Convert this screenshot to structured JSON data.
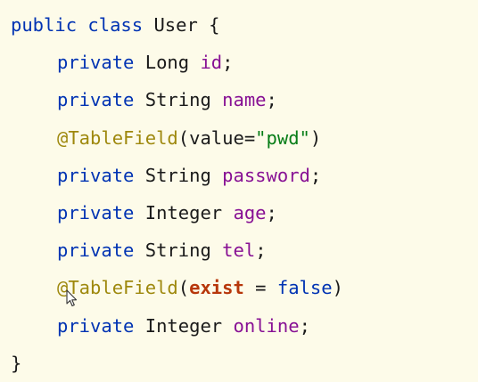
{
  "editor": {
    "lines": [
      {
        "indent": false,
        "tokens": [
          {
            "text": "public",
            "cls": "kw"
          },
          {
            "text": " class ",
            "cls": "kw"
          },
          {
            "text": "User {",
            "cls": "plain"
          }
        ]
      },
      {
        "indent": true,
        "tokens": [
          {
            "text": "private",
            "cls": "kw"
          },
          {
            "text": " Long ",
            "cls": "type"
          },
          {
            "text": "id",
            "cls": "field"
          },
          {
            "text": ";",
            "cls": "plain"
          }
        ]
      },
      {
        "indent": true,
        "tokens": [
          {
            "text": "private",
            "cls": "kw"
          },
          {
            "text": " String ",
            "cls": "type"
          },
          {
            "text": "name",
            "cls": "field"
          },
          {
            "text": ";",
            "cls": "plain"
          }
        ]
      },
      {
        "indent": true,
        "tokens": [
          {
            "text": "@TableField",
            "cls": "anno"
          },
          {
            "text": "(value=",
            "cls": "plain"
          },
          {
            "text": "\"pwd\"",
            "cls": "str"
          },
          {
            "text": ")",
            "cls": "plain"
          }
        ]
      },
      {
        "indent": true,
        "tokens": [
          {
            "text": "private",
            "cls": "kw"
          },
          {
            "text": " String ",
            "cls": "type"
          },
          {
            "text": "password",
            "cls": "field"
          },
          {
            "text": ";",
            "cls": "plain"
          }
        ]
      },
      {
        "indent": true,
        "tokens": [
          {
            "text": "private",
            "cls": "kw"
          },
          {
            "text": " Integer ",
            "cls": "type"
          },
          {
            "text": "age",
            "cls": "field"
          },
          {
            "text": ";",
            "cls": "plain"
          }
        ]
      },
      {
        "indent": true,
        "tokens": [
          {
            "text": "private",
            "cls": "kw"
          },
          {
            "text": " String ",
            "cls": "type"
          },
          {
            "text": "tel",
            "cls": "field"
          },
          {
            "text": ";",
            "cls": "plain"
          }
        ]
      },
      {
        "indent": true,
        "tokens": [
          {
            "text": "@TableField",
            "cls": "anno"
          },
          {
            "text": "(",
            "cls": "plain"
          },
          {
            "text": "exist",
            "cls": "attr-bold"
          },
          {
            "text": " = ",
            "cls": "plain"
          },
          {
            "text": "false",
            "cls": "kw"
          },
          {
            "text": ")",
            "cls": "plain"
          }
        ]
      },
      {
        "indent": true,
        "tokens": [
          {
            "text": "private",
            "cls": "kw"
          },
          {
            "text": " Integer ",
            "cls": "type"
          },
          {
            "text": "online",
            "cls": "field"
          },
          {
            "text": ";",
            "cls": "plain"
          }
        ]
      },
      {
        "indent": false,
        "tokens": [
          {
            "text": "}",
            "cls": "plain"
          }
        ]
      }
    ]
  },
  "colors": {
    "background": "#fdfbe9",
    "keyword": "#0033b3",
    "field": "#871094",
    "annotation": "#9e880d",
    "string": "#067d17",
    "attribute": "#b7370a"
  },
  "cursor": {
    "icon": "mouse-pointer-icon"
  }
}
